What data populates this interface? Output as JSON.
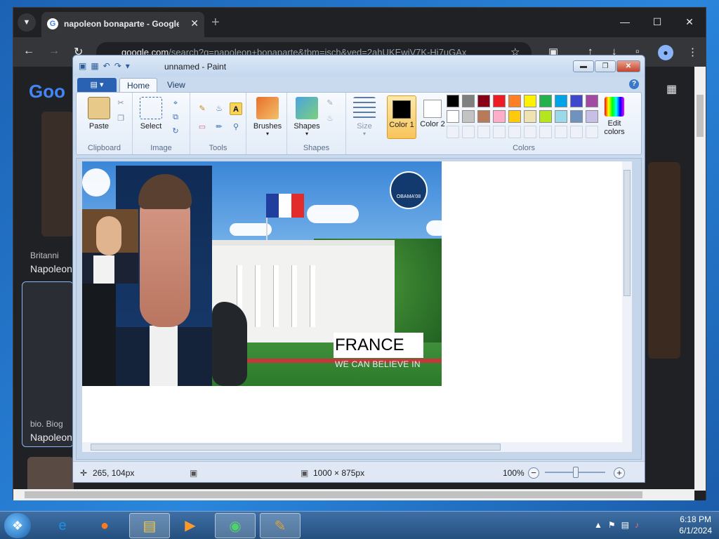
{
  "browser": {
    "tab_title": "napoleon bonaparte - Google",
    "url_host": "google.com",
    "url_path": "/search?q=napoleon+bonaparte&tbm=isch&ved=2ahUKEwiV7K-Hi7uGAx",
    "google_logo": "Goo",
    "results": [
      {
        "source": "Britanni",
        "title": "Napoleon"
      },
      {
        "source": "bio. Biog",
        "title": "Napoleon"
      }
    ]
  },
  "paint": {
    "window_title": "unnamed - Paint",
    "tabs": [
      "Home",
      "View"
    ],
    "groups": {
      "clipboard": {
        "label": "Clipboard",
        "paste": "Paste"
      },
      "image": {
        "label": "Image",
        "select": "Select"
      },
      "tools": {
        "label": "Tools"
      },
      "brushes": {
        "label": "Brushes"
      },
      "shapes": {
        "label": "Shapes",
        "shapes": "Shapes"
      },
      "size": {
        "label": "Size"
      },
      "colors": {
        "label": "Colors",
        "color1": "Color 1",
        "color2": "Color 2",
        "edit": "Edit colors"
      }
    },
    "color1_value": "#000000",
    "color2_value": "#ffffff",
    "palette": [
      "#000000",
      "#7f7f7f",
      "#880015",
      "#ed1c24",
      "#ff7f27",
      "#fff200",
      "#22b14c",
      "#00a2e8",
      "#3f48cc",
      "#a349a4",
      "#ffffff",
      "#c3c3c3",
      "#b97a57",
      "#ffaec9",
      "#ffc90e",
      "#efe4b0",
      "#b5e61d",
      "#99d9ea",
      "#7092be",
      "#c8bfe7"
    ],
    "canvas": {
      "headline": "FRANCE",
      "slogan": "WE CAN BELIEVE IN",
      "badge": "OBAMA'08"
    },
    "status": {
      "cursor": "265, 104px",
      "dimensions": "1000 × 875px",
      "zoom": "100%"
    }
  },
  "taskbar": {
    "time": "6:18 PM",
    "date": "6/1/2024"
  }
}
